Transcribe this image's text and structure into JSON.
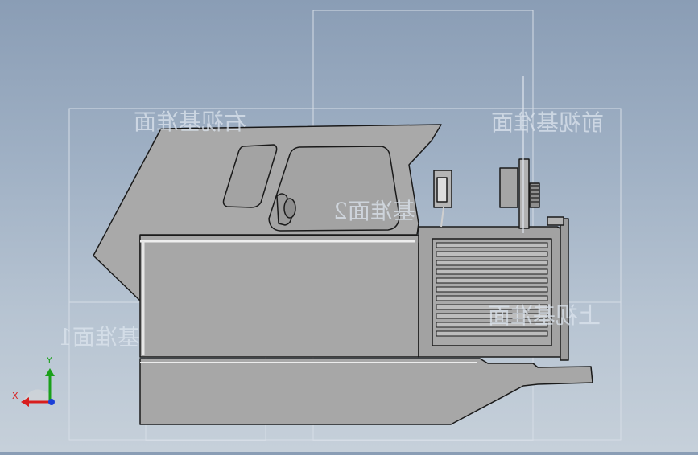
{
  "planes": {
    "right": "右视基准面",
    "front": "前视基准面",
    "top": "上视基准面",
    "datum1": "基准面1",
    "datum2": "基准面2"
  },
  "triad": {
    "x_label": "X",
    "y_label": "Y",
    "x_color": "#d81e1e",
    "y_color": "#1aa01a",
    "z_color": "#1a3fd8"
  },
  "colors": {
    "body": "#a7a7a7",
    "body_dark": "#8f8f8f",
    "outline": "#1a1a1a",
    "plane_line": "#d6dde6"
  }
}
